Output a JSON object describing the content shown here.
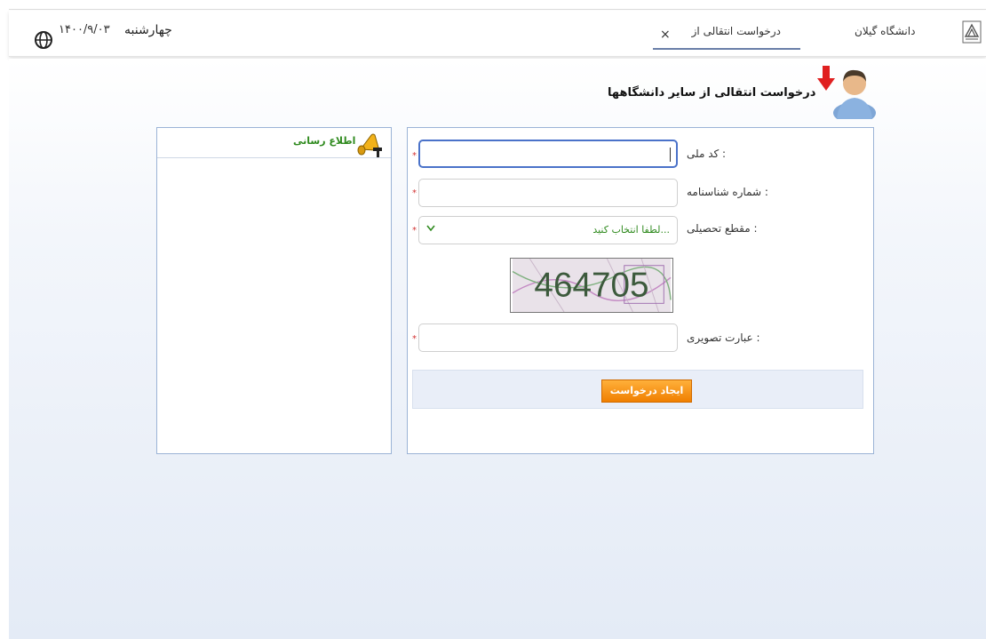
{
  "header": {
    "date": "۱۴۰۰/۹/۰۳",
    "weekday": "چهارشنبه",
    "university": "دانشگاه گیلان",
    "tab_label": "درخواست انتقالی از",
    "tab_close": "×",
    "icons": [
      "globe-icon",
      "university-logo-icon",
      "close-icon"
    ]
  },
  "page": {
    "title": "درخواست انتقالی از سایر دانشگاهها",
    "title_icon": "user-download-icon"
  },
  "notice_panel": {
    "title": "اطلاع رسانی",
    "icon": "megaphone-icon"
  },
  "form": {
    "national_code_label": "کد ملی :",
    "national_code_value": "",
    "id_number_label": "شماره شناسنامه :",
    "id_number_value": "",
    "degree_label": "مقطع تحصیلی :",
    "degree_selected": "لطفا انتخاب کنید...",
    "captcha_text": "464705",
    "captcha_label": "عبارت تصویری :",
    "captcha_value": "",
    "required_mark": "*",
    "submit_label": "ایجاد درخواست"
  },
  "colors": {
    "accent": "#4a72c9",
    "panel_border": "#9bb3d6",
    "notice_green": "#2f8a1e",
    "submit_orange": "#f08a10",
    "required_red": "#d23333"
  }
}
